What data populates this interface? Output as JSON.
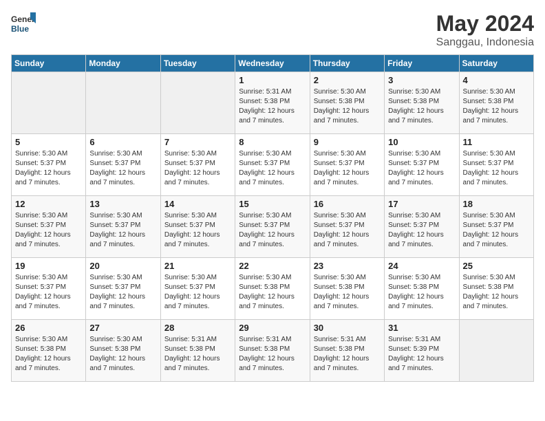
{
  "header": {
    "logo_general": "General",
    "logo_blue": "Blue",
    "month": "May 2024",
    "location": "Sanggau, Indonesia"
  },
  "days_of_week": [
    "Sunday",
    "Monday",
    "Tuesday",
    "Wednesday",
    "Thursday",
    "Friday",
    "Saturday"
  ],
  "weeks": [
    [
      {
        "day": "",
        "info": ""
      },
      {
        "day": "",
        "info": ""
      },
      {
        "day": "",
        "info": ""
      },
      {
        "day": "1",
        "info": "Sunrise: 5:31 AM\nSunset: 5:38 PM\nDaylight: 12 hours\nand 7 minutes."
      },
      {
        "day": "2",
        "info": "Sunrise: 5:30 AM\nSunset: 5:38 PM\nDaylight: 12 hours\nand 7 minutes."
      },
      {
        "day": "3",
        "info": "Sunrise: 5:30 AM\nSunset: 5:38 PM\nDaylight: 12 hours\nand 7 minutes."
      },
      {
        "day": "4",
        "info": "Sunrise: 5:30 AM\nSunset: 5:38 PM\nDaylight: 12 hours\nand 7 minutes."
      }
    ],
    [
      {
        "day": "5",
        "info": "Sunrise: 5:30 AM\nSunset: 5:37 PM\nDaylight: 12 hours\nand 7 minutes."
      },
      {
        "day": "6",
        "info": "Sunrise: 5:30 AM\nSunset: 5:37 PM\nDaylight: 12 hours\nand 7 minutes."
      },
      {
        "day": "7",
        "info": "Sunrise: 5:30 AM\nSunset: 5:37 PM\nDaylight: 12 hours\nand 7 minutes."
      },
      {
        "day": "8",
        "info": "Sunrise: 5:30 AM\nSunset: 5:37 PM\nDaylight: 12 hours\nand 7 minutes."
      },
      {
        "day": "9",
        "info": "Sunrise: 5:30 AM\nSunset: 5:37 PM\nDaylight: 12 hours\nand 7 minutes."
      },
      {
        "day": "10",
        "info": "Sunrise: 5:30 AM\nSunset: 5:37 PM\nDaylight: 12 hours\nand 7 minutes."
      },
      {
        "day": "11",
        "info": "Sunrise: 5:30 AM\nSunset: 5:37 PM\nDaylight: 12 hours\nand 7 minutes."
      }
    ],
    [
      {
        "day": "12",
        "info": "Sunrise: 5:30 AM\nSunset: 5:37 PM\nDaylight: 12 hours\nand 7 minutes."
      },
      {
        "day": "13",
        "info": "Sunrise: 5:30 AM\nSunset: 5:37 PM\nDaylight: 12 hours\nand 7 minutes."
      },
      {
        "day": "14",
        "info": "Sunrise: 5:30 AM\nSunset: 5:37 PM\nDaylight: 12 hours\nand 7 minutes."
      },
      {
        "day": "15",
        "info": "Sunrise: 5:30 AM\nSunset: 5:37 PM\nDaylight: 12 hours\nand 7 minutes."
      },
      {
        "day": "16",
        "info": "Sunrise: 5:30 AM\nSunset: 5:37 PM\nDaylight: 12 hours\nand 7 minutes."
      },
      {
        "day": "17",
        "info": "Sunrise: 5:30 AM\nSunset: 5:37 PM\nDaylight: 12 hours\nand 7 minutes."
      },
      {
        "day": "18",
        "info": "Sunrise: 5:30 AM\nSunset: 5:37 PM\nDaylight: 12 hours\nand 7 minutes."
      }
    ],
    [
      {
        "day": "19",
        "info": "Sunrise: 5:30 AM\nSunset: 5:37 PM\nDaylight: 12 hours\nand 7 minutes."
      },
      {
        "day": "20",
        "info": "Sunrise: 5:30 AM\nSunset: 5:37 PM\nDaylight: 12 hours\nand 7 minutes."
      },
      {
        "day": "21",
        "info": "Sunrise: 5:30 AM\nSunset: 5:37 PM\nDaylight: 12 hours\nand 7 minutes."
      },
      {
        "day": "22",
        "info": "Sunrise: 5:30 AM\nSunset: 5:38 PM\nDaylight: 12 hours\nand 7 minutes."
      },
      {
        "day": "23",
        "info": "Sunrise: 5:30 AM\nSunset: 5:38 PM\nDaylight: 12 hours\nand 7 minutes."
      },
      {
        "day": "24",
        "info": "Sunrise: 5:30 AM\nSunset: 5:38 PM\nDaylight: 12 hours\nand 7 minutes."
      },
      {
        "day": "25",
        "info": "Sunrise: 5:30 AM\nSunset: 5:38 PM\nDaylight: 12 hours\nand 7 minutes."
      }
    ],
    [
      {
        "day": "26",
        "info": "Sunrise: 5:30 AM\nSunset: 5:38 PM\nDaylight: 12 hours\nand 7 minutes."
      },
      {
        "day": "27",
        "info": "Sunrise: 5:30 AM\nSunset: 5:38 PM\nDaylight: 12 hours\nand 7 minutes."
      },
      {
        "day": "28",
        "info": "Sunrise: 5:31 AM\nSunset: 5:38 PM\nDaylight: 12 hours\nand 7 minutes."
      },
      {
        "day": "29",
        "info": "Sunrise: 5:31 AM\nSunset: 5:38 PM\nDaylight: 12 hours\nand 7 minutes."
      },
      {
        "day": "30",
        "info": "Sunrise: 5:31 AM\nSunset: 5:38 PM\nDaylight: 12 hours\nand 7 minutes."
      },
      {
        "day": "31",
        "info": "Sunrise: 5:31 AM\nSunset: 5:39 PM\nDaylight: 12 hours\nand 7 minutes."
      },
      {
        "day": "",
        "info": ""
      }
    ]
  ]
}
